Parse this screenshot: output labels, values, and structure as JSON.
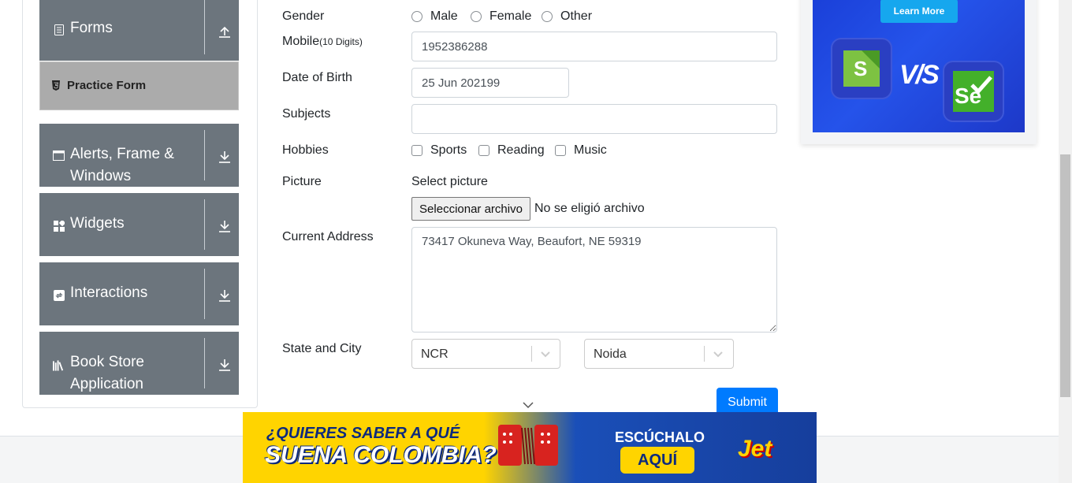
{
  "sidebar": {
    "groups": [
      {
        "label": "Forms",
        "icon": "form-icon",
        "arrow": "collapse-up-icon"
      },
      {
        "label": "Alerts, Frame &",
        "label2": "Windows",
        "icon": "window-icon",
        "arrow": "expand-down-icon"
      },
      {
        "label": "Widgets",
        "icon": "widgets-icon",
        "arrow": "expand-down-icon"
      },
      {
        "label": "Interactions",
        "icon": "interactions-icon",
        "arrow": "expand-down-icon"
      },
      {
        "label": "Book Store",
        "label2": "Application",
        "icon": "books-icon",
        "arrow": "expand-down-icon"
      }
    ],
    "active_item": "Practice Form"
  },
  "form": {
    "gender_label": "Gender",
    "gender_options": [
      "Male",
      "Female",
      "Other"
    ],
    "mobile_label": "Mobile",
    "mobile_hint": "(10 Digits)",
    "mobile_value": "1952386288",
    "dob_label": "Date of Birth",
    "dob_value": "25 Jun 202199",
    "subjects_label": "Subjects",
    "subjects_value": "",
    "hobbies_label": "Hobbies",
    "hobbies_options": [
      "Sports",
      "Reading",
      "Music"
    ],
    "picture_label": "Picture",
    "picture_hint": "Select picture",
    "file_button": "Seleccionar archivo",
    "file_status": "No se eligió archivo",
    "address_label": "Current Address",
    "address_value": "73417 Okuneva Way, Beaufort, NE 59319",
    "state_city_label": "State and City",
    "state_value": "NCR",
    "city_value": "Noida",
    "submit_label": "Submit"
  },
  "ads": {
    "right": {
      "button": "Learn More",
      "vs": "V/S",
      "logo_left": "S",
      "logo_right": "Se"
    },
    "banner": {
      "line1": "¿QUIERES SABER A QUÉ",
      "line2": "SUENA COLOMBIA?",
      "cta_top": "ESCÚCHALO",
      "cta": "AQUÍ",
      "brand": "Jet"
    }
  },
  "colors": {
    "sidebar_group": "#6c757d",
    "practice_active": "#ababab",
    "primary": "#007bff"
  }
}
